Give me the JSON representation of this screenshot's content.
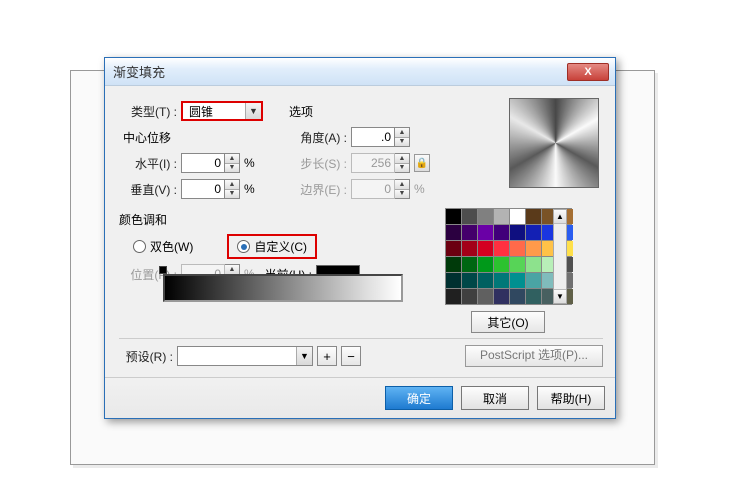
{
  "dialog": {
    "title": "渐变填充",
    "close_glyph": "X"
  },
  "type": {
    "label": "类型(T) :",
    "value": "圆锥"
  },
  "options": {
    "label": "选项"
  },
  "angle": {
    "label": "角度(A) :",
    "value": ".0"
  },
  "center": {
    "label": "中心位移"
  },
  "horiz": {
    "label": "水平(I) :",
    "value": "0"
  },
  "vert": {
    "label": "垂直(V) :",
    "value": "0"
  },
  "step": {
    "label": "步长(S) :",
    "value": "256"
  },
  "edge": {
    "label": "边界(E) :",
    "value": "0"
  },
  "pct": "%",
  "blend": {
    "label": "颜色调和"
  },
  "twocolor": {
    "label": "双色(W)"
  },
  "custom": {
    "label": "自定义(C)"
  },
  "pos": {
    "label": "位置(P) :",
    "value": "0"
  },
  "current": {
    "label": "当前(U) :"
  },
  "other_btn": "其它(O)",
  "preset": {
    "label": "预设(R) :"
  },
  "add_glyph": "+",
  "del_glyph": "−",
  "ps_btn": "PostScript 选项(P)...",
  "footer": {
    "ok": "确定",
    "cancel": "取消",
    "help": "帮助(H)"
  },
  "swatches": [
    "#000000",
    "#4d4d4d",
    "#808080",
    "#b3b3b3",
    "#ffffff",
    "#5a3a1a",
    "#7a5326",
    "#a56f33",
    "#2b0040",
    "#44006b",
    "#6a00a6",
    "#41007a",
    "#0f0f80",
    "#1320b4",
    "#1a36e0",
    "#2a5df0",
    "#6b0010",
    "#a30018",
    "#d40020",
    "#ff3040",
    "#ff6a4a",
    "#ff9a4a",
    "#ffc247",
    "#ffe04a",
    "#003a0a",
    "#006612",
    "#00991a",
    "#2cc22f",
    "#57d457",
    "#8de28d",
    "#b8efb8",
    "#505050",
    "#003030",
    "#004848",
    "#006060",
    "#007878",
    "#009090",
    "#4aa4a4",
    "#80bcbc",
    "#707070",
    "#202020",
    "#404040",
    "#606060",
    "#303060",
    "#304860",
    "#306060",
    "#486060",
    "#606048"
  ]
}
